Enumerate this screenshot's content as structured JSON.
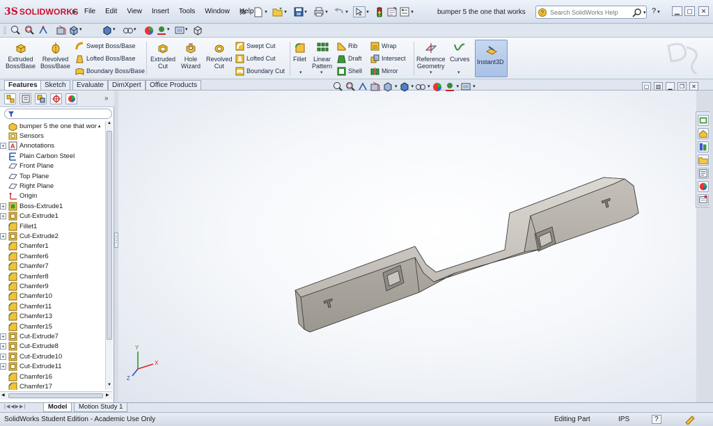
{
  "app": {
    "brand_prefix": "3S",
    "brand": "SOLIDWORKS"
  },
  "menu": [
    "File",
    "Edit",
    "View",
    "Insert",
    "Tools",
    "Window",
    "Help"
  ],
  "document_title": "bumper 5 the one that works",
  "search": {
    "placeholder": "Search SolidWorks Help"
  },
  "help": {
    "label": "?"
  },
  "command_manager": {
    "extruded_boss": [
      "Extruded",
      "Boss/Base"
    ],
    "revolved_boss": [
      "Revolved",
      "Boss/Base"
    ],
    "swept_boss": "Swept Boss/Base",
    "lofted_boss": "Lofted Boss/Base",
    "boundary_boss": "Boundary Boss/Base",
    "extruded_cut": [
      "Extruded",
      "Cut"
    ],
    "hole_wizard": [
      "Hole",
      "Wizard"
    ],
    "revolved_cut": [
      "Revolved",
      "Cut"
    ],
    "swept_cut": "Swept Cut",
    "lofted_cut": "Lofted Cut",
    "boundary_cut": "Boundary Cut",
    "fillet": "Fillet",
    "linear_pattern": [
      "Linear",
      "Pattern"
    ],
    "rib": "Rib",
    "draft": "Draft",
    "shell": "Shell",
    "wrap": "Wrap",
    "intersect": "Intersect",
    "mirror": "Mirror",
    "reference_geometry": [
      "Reference",
      "Geometry"
    ],
    "curves": "Curves",
    "instant3d": "Instant3D"
  },
  "tabs": [
    "Features",
    "Sketch",
    "Evaluate",
    "DimXpert",
    "Office Products"
  ],
  "feature_tree": [
    {
      "label": "bumper 5 the one that wor",
      "icon": "part",
      "expander": ""
    },
    {
      "label": "Sensors",
      "icon": "sensor",
      "expander": ""
    },
    {
      "label": "Annotations",
      "icon": "annotation",
      "expander": "+"
    },
    {
      "label": "Plain Carbon Steel",
      "icon": "material",
      "expander": ""
    },
    {
      "label": "Front Plane",
      "icon": "plane",
      "expander": ""
    },
    {
      "label": "Top Plane",
      "icon": "plane",
      "expander": ""
    },
    {
      "label": "Right Plane",
      "icon": "plane",
      "expander": ""
    },
    {
      "label": "Origin",
      "icon": "origin",
      "expander": ""
    },
    {
      "label": "Boss-Extrude1",
      "icon": "extrude",
      "expander": "+"
    },
    {
      "label": "Cut-Extrude1",
      "icon": "cut",
      "expander": "+"
    },
    {
      "label": "Fillet1",
      "icon": "fillet",
      "expander": ""
    },
    {
      "label": "Cut-Extrude2",
      "icon": "cut",
      "expander": "+"
    },
    {
      "label": "Chamfer1",
      "icon": "chamfer",
      "expander": ""
    },
    {
      "label": "Chamfer6",
      "icon": "chamfer",
      "expander": ""
    },
    {
      "label": "Chamfer7",
      "icon": "chamfer",
      "expander": ""
    },
    {
      "label": "Chamfer8",
      "icon": "chamfer",
      "expander": ""
    },
    {
      "label": "Chamfer9",
      "icon": "chamfer",
      "expander": ""
    },
    {
      "label": "Chamfer10",
      "icon": "chamfer",
      "expander": ""
    },
    {
      "label": "Chamfer11",
      "icon": "chamfer",
      "expander": ""
    },
    {
      "label": "Chamfer13",
      "icon": "chamfer",
      "expander": ""
    },
    {
      "label": "Chamfer15",
      "icon": "chamfer",
      "expander": ""
    },
    {
      "label": "Cut-Extrude7",
      "icon": "cut",
      "expander": "+"
    },
    {
      "label": "Cut-Extrude8",
      "icon": "cut",
      "expander": "+"
    },
    {
      "label": "Cut-Extrude10",
      "icon": "cut",
      "expander": "+"
    },
    {
      "label": "Cut-Extrude11",
      "icon": "cut",
      "expander": "+"
    },
    {
      "label": "Chamfer16",
      "icon": "chamfer",
      "expander": ""
    },
    {
      "label": "Chamfer17",
      "icon": "chamfer",
      "expander": ""
    }
  ],
  "bottom_tabs": [
    "Model",
    "Motion Study 1"
  ],
  "status": {
    "edition": "SolidWorks Student Edition - Academic Use Only",
    "mode": "Editing Part",
    "units": "IPS",
    "help": "?"
  },
  "triad": {
    "x": "X",
    "y": "Y",
    "z": "Z"
  },
  "colors": {
    "brand_red": "#c8102e",
    "model_face": "#c8c4bf",
    "model_edge": "#3a3a3a",
    "accent_blue": "#3a6fb5"
  }
}
